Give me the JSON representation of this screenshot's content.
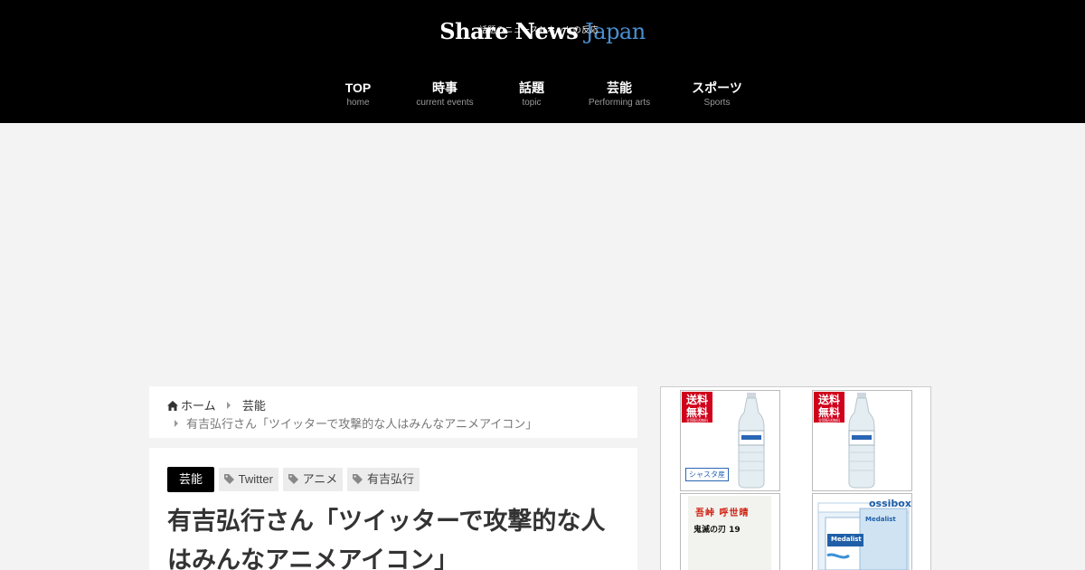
{
  "site": {
    "name_main": "Share News",
    "name_accent": "Japan",
    "tagline": "話題のニュースとネットの反応"
  },
  "nav": [
    {
      "label": "TOP",
      "sub": "home"
    },
    {
      "label": "時事",
      "sub": "current events"
    },
    {
      "label": "話題",
      "sub": "topic"
    },
    {
      "label": "芸能",
      "sub": "Performing arts"
    },
    {
      "label": "スポーツ",
      "sub": "Sports"
    }
  ],
  "breadcrumb": {
    "home": "ホーム",
    "category": "芸能",
    "current": "有吉弘行さん「ツイッターで攻撃的な人はみんなアニメアイコン」"
  },
  "article": {
    "category": "芸能",
    "tags": [
      "Twitter",
      "アニメ",
      "有吉弘行"
    ],
    "title": "有吉弘行さん「ツイッターで攻撃的な人はみんなアニメアイコン」"
  },
  "sidebar": {
    "products": [
      {
        "ribbon": "送料無料",
        "ribbon_small": "全国配送無料",
        "label": "シャスタ産"
      },
      {
        "ribbon": "送料無料",
        "ribbon_small": "全国配送無料"
      },
      {
        "author": "吾峠 呼世晴",
        "title": "鬼滅の刃 19"
      },
      {
        "brand": "Medalist",
        "brand_box": "Medalist",
        "box_label": "ossibox"
      }
    ]
  },
  "colors": {
    "header_bg": "#000000",
    "logo_accent": "#4a8fd0",
    "page_bg": "#f3f3f3",
    "ribbon_red": "#d0021b"
  }
}
